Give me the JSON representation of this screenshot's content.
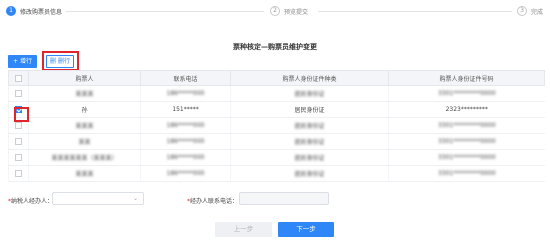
{
  "steps": [
    {
      "num": "1",
      "label": "修改购票员信息",
      "state": "active"
    },
    {
      "num": "2",
      "label": "预览提交",
      "state": "inactive"
    },
    {
      "num": "3",
      "label": "完成",
      "state": "inactive"
    }
  ],
  "title": "票种核定—购票员维护变更",
  "toolbar": {
    "add_label": "+ 增行",
    "delete_label": "删 删行"
  },
  "table": {
    "columns": [
      "",
      "购票人",
      "联系电话",
      "购票人身份证件种类",
      "购票人身份证件号码"
    ],
    "rows": [
      {
        "checked": false,
        "name": "某某某",
        "phone": "186*****000",
        "id_type": "居民身份证",
        "id_number": "3301*********0000"
      },
      {
        "checked": true,
        "name": "孙",
        "phone": "151*****",
        "id_type": "居民身份证",
        "id_number": "2323*********"
      },
      {
        "checked": false,
        "name": "某某某",
        "phone": "186*****000",
        "id_type": "居民身份证",
        "id_number": "3301*********0000"
      },
      {
        "checked": false,
        "name": "某某",
        "phone": "186*****000",
        "id_type": "居民身份证",
        "id_number": "3301*********0000"
      },
      {
        "checked": false,
        "name": "某某某某某某（某某某）",
        "phone": "186*****000",
        "id_type": "居民身份证",
        "id_number": "3301*********0000"
      },
      {
        "checked": false,
        "name": "某某某",
        "phone": "186*****000",
        "id_type": "居民身份证",
        "id_number": "3301*********0000"
      }
    ]
  },
  "form": {
    "agent_label": "纳税人经办人：",
    "agent_required": "*",
    "agent_value": "",
    "phone_label": "经办人联系电话：",
    "phone_required": "*",
    "phone_value": ""
  },
  "buttons": {
    "prev_label": "上一步",
    "next_label": "下一步"
  },
  "colors": {
    "accent": "#2f86f6",
    "highlight": "#e0262c"
  }
}
